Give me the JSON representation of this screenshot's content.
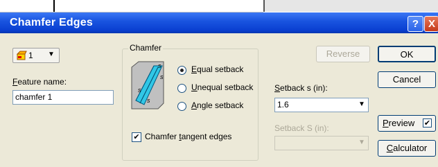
{
  "dialog": {
    "title": "Chamfer Edges",
    "help_label": "?",
    "close_label": "X"
  },
  "feature_selector": {
    "value": "1",
    "dropdown_icon": "chevron-down-icon"
  },
  "feature_name": {
    "label": "Feature name:",
    "value": "chamfer 1"
  },
  "chamfer_group": {
    "title": "Chamfer",
    "options": [
      "Equal setback",
      "Unequal setback",
      "Angle setback"
    ],
    "selected": "Equal setback",
    "diagram_labels": {
      "top": "s",
      "side": "s",
      "lower_left": "s",
      "lower_right": "s"
    },
    "tangent_edges": {
      "label": "Chamfer tangent edges",
      "checked": true
    }
  },
  "setback_s": {
    "label": "Setback s (in):",
    "value": "1.6"
  },
  "setback_S": {
    "label": "Setback S (in):",
    "value": ""
  },
  "buttons": {
    "reverse": "Reverse",
    "ok": "OK",
    "cancel": "Cancel",
    "preview": "Preview",
    "calculator": "Calculator"
  },
  "preview_checked": true,
  "colors": {
    "title_bar": "#0a3fd1",
    "dialog_bg": "#ece9d8",
    "diagram_cyan": "#31c7e6"
  }
}
